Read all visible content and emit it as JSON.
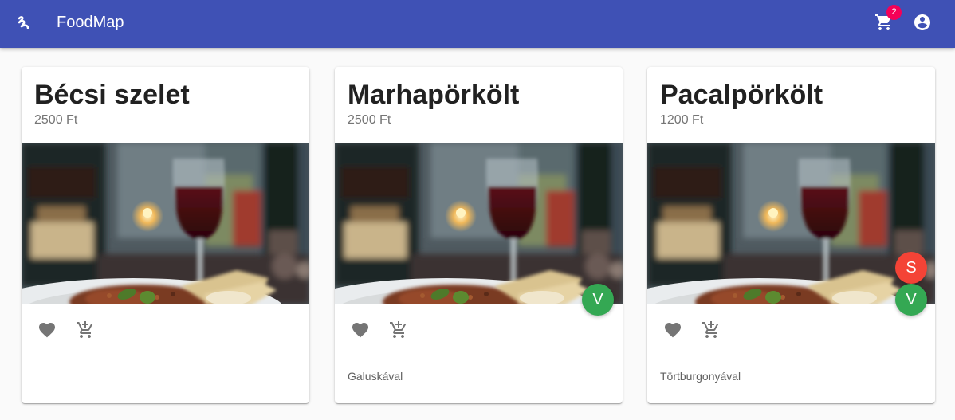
{
  "app": {
    "title": "FoodMap",
    "logo_icon": "squiggle-logo-icon",
    "cart_icon": "shopping-cart-icon",
    "cart_count": "2",
    "account_icon": "account-circle-icon",
    "brand_color": "#3f51b5",
    "badge_color": "#f50057"
  },
  "foods": [
    {
      "name": "Bécsi szelet",
      "price": "2500 Ft",
      "description": "",
      "tags": []
    },
    {
      "name": "Marhapörkölt",
      "price": "2500 Ft",
      "description": "Galuskával",
      "tags": [
        "V"
      ]
    },
    {
      "name": "Pacalpörkölt",
      "price": "1200 Ft",
      "description": "Törtburgonyával",
      "tags": [
        "S",
        "V"
      ]
    }
  ],
  "icons": {
    "favorite": "heart-icon",
    "add_to_cart": "add-shopping-cart-icon"
  },
  "tag_colors": {
    "V": "#34a853",
    "S": "#f44336"
  }
}
